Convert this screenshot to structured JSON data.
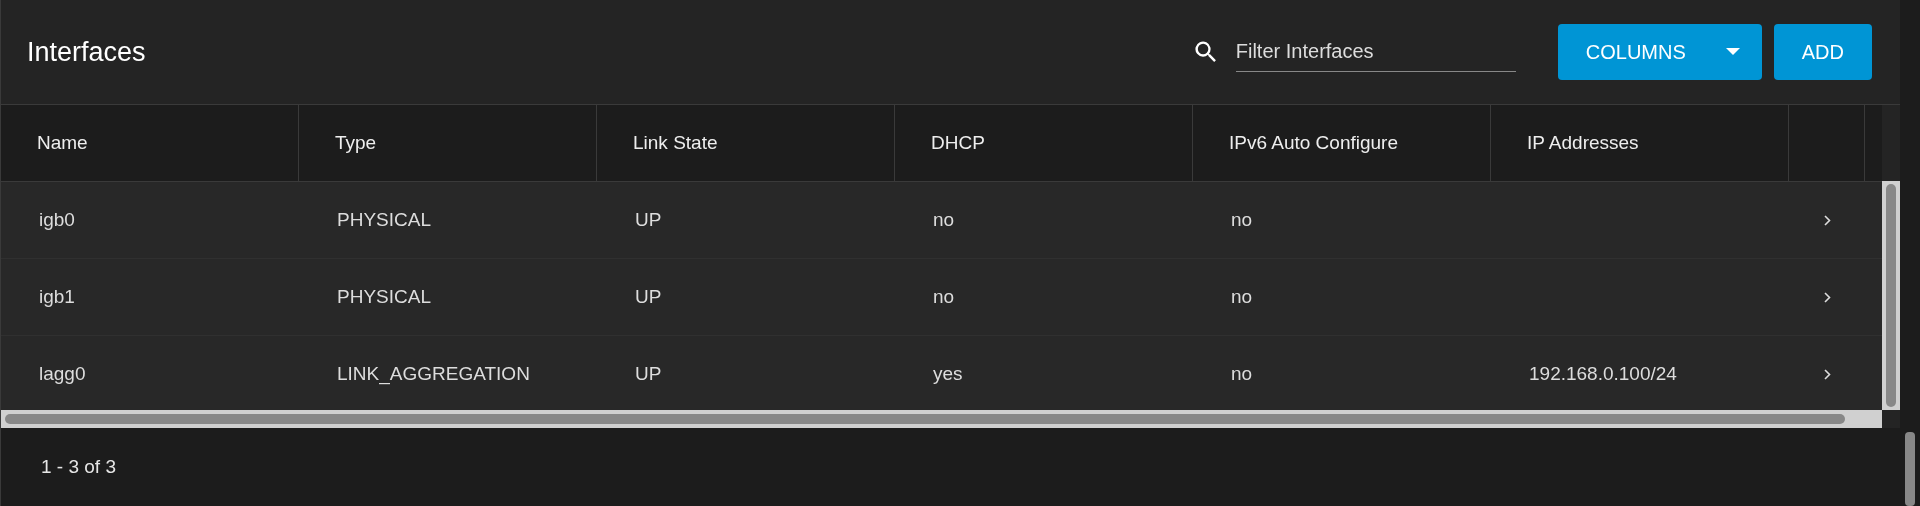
{
  "title": "Interfaces",
  "search": {
    "placeholder": "Filter Interfaces"
  },
  "buttons": [
    {
      "label": "COLUMNS",
      "kind": "dropdown"
    },
    {
      "label": "ADD",
      "kind": "plain"
    }
  ],
  "table": {
    "columns": [
      "Name",
      "Type",
      "Link State",
      "DHCP",
      "IPv6 Auto Configure",
      "IP Addresses"
    ],
    "rows": [
      {
        "cells": [
          "igb0",
          "PHYSICAL",
          "UP",
          "no",
          "no",
          ""
        ]
      },
      {
        "cells": [
          "igb1",
          "PHYSICAL",
          "UP",
          "no",
          "no",
          ""
        ]
      },
      {
        "cells": [
          "lagg0",
          "LINK_AGGREGATION",
          "UP",
          "yes",
          "no",
          "192.168.0.100/24"
        ]
      }
    ]
  },
  "pagination": "1 - 3 of 3"
}
